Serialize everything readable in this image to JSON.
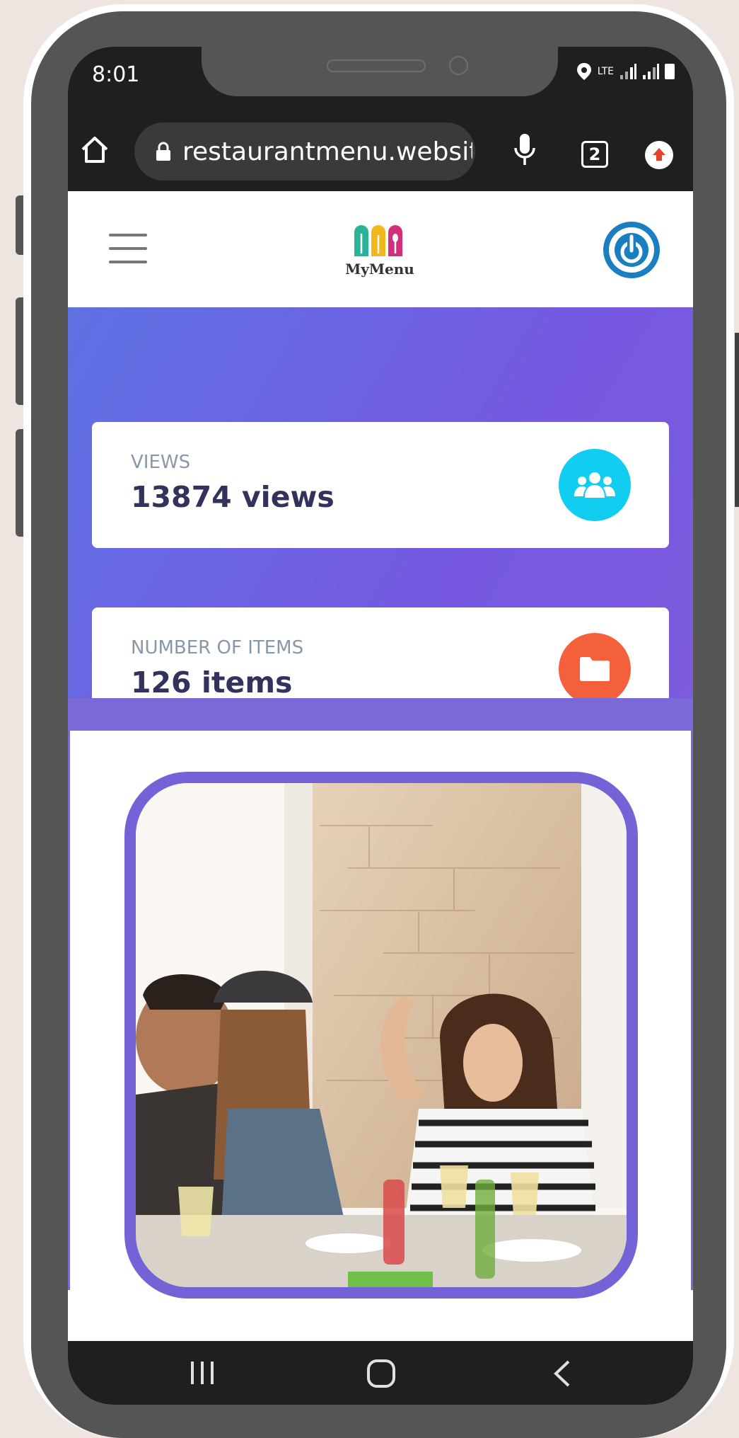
{
  "status_bar": {
    "time": "8:01",
    "network": "LTE",
    "icons": [
      "location-icon",
      "signal-icon",
      "signal-icon",
      "battery-icon"
    ]
  },
  "browser": {
    "url": "restaurantmenu.website/",
    "tab_count": "2",
    "icons": [
      "home-icon",
      "lock-icon",
      "mic-icon",
      "tabs-icon",
      "update-icon"
    ]
  },
  "header": {
    "logo_text": "MyMenu",
    "icons": [
      "menu-icon",
      "power-icon"
    ]
  },
  "stats": [
    {
      "label": "VIEWS",
      "value": "13874 views",
      "icon": "users-icon",
      "color": "#11cdef"
    },
    {
      "label": "NUMBER OF ITEMS",
      "value": "126 items",
      "icon": "folder-icon",
      "color": "#f5603c"
    }
  ],
  "colors": {
    "gradient_start": "#5f72e4",
    "gradient_end": "#7c5bdc",
    "frame": "#7463d6",
    "power": "#1a7fc1"
  },
  "nav": {
    "icons": [
      "recent-apps-icon",
      "home-nav-icon",
      "back-icon"
    ]
  }
}
